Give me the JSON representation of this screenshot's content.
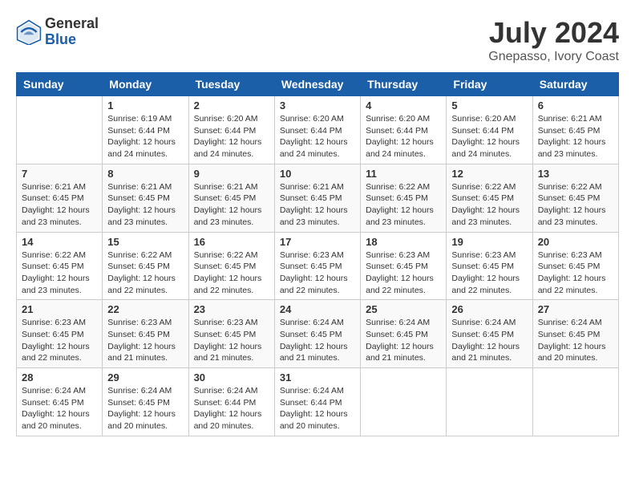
{
  "header": {
    "logo_general": "General",
    "logo_blue": "Blue",
    "month_year": "July 2024",
    "location": "Gnepasso, Ivory Coast"
  },
  "days_of_week": [
    "Sunday",
    "Monday",
    "Tuesday",
    "Wednesday",
    "Thursday",
    "Friday",
    "Saturday"
  ],
  "weeks": [
    [
      {
        "day": "",
        "sunrise": "",
        "sunset": "",
        "daylight": ""
      },
      {
        "day": "1",
        "sunrise": "Sunrise: 6:19 AM",
        "sunset": "Sunset: 6:44 PM",
        "daylight": "Daylight: 12 hours and 24 minutes."
      },
      {
        "day": "2",
        "sunrise": "Sunrise: 6:20 AM",
        "sunset": "Sunset: 6:44 PM",
        "daylight": "Daylight: 12 hours and 24 minutes."
      },
      {
        "day": "3",
        "sunrise": "Sunrise: 6:20 AM",
        "sunset": "Sunset: 6:44 PM",
        "daylight": "Daylight: 12 hours and 24 minutes."
      },
      {
        "day": "4",
        "sunrise": "Sunrise: 6:20 AM",
        "sunset": "Sunset: 6:44 PM",
        "daylight": "Daylight: 12 hours and 24 minutes."
      },
      {
        "day": "5",
        "sunrise": "Sunrise: 6:20 AM",
        "sunset": "Sunset: 6:44 PM",
        "daylight": "Daylight: 12 hours and 24 minutes."
      },
      {
        "day": "6",
        "sunrise": "Sunrise: 6:21 AM",
        "sunset": "Sunset: 6:45 PM",
        "daylight": "Daylight: 12 hours and 23 minutes."
      }
    ],
    [
      {
        "day": "7",
        "sunrise": "Sunrise: 6:21 AM",
        "sunset": "Sunset: 6:45 PM",
        "daylight": "Daylight: 12 hours and 23 minutes."
      },
      {
        "day": "8",
        "sunrise": "Sunrise: 6:21 AM",
        "sunset": "Sunset: 6:45 PM",
        "daylight": "Daylight: 12 hours and 23 minutes."
      },
      {
        "day": "9",
        "sunrise": "Sunrise: 6:21 AM",
        "sunset": "Sunset: 6:45 PM",
        "daylight": "Daylight: 12 hours and 23 minutes."
      },
      {
        "day": "10",
        "sunrise": "Sunrise: 6:21 AM",
        "sunset": "Sunset: 6:45 PM",
        "daylight": "Daylight: 12 hours and 23 minutes."
      },
      {
        "day": "11",
        "sunrise": "Sunrise: 6:22 AM",
        "sunset": "Sunset: 6:45 PM",
        "daylight": "Daylight: 12 hours and 23 minutes."
      },
      {
        "day": "12",
        "sunrise": "Sunrise: 6:22 AM",
        "sunset": "Sunset: 6:45 PM",
        "daylight": "Daylight: 12 hours and 23 minutes."
      },
      {
        "day": "13",
        "sunrise": "Sunrise: 6:22 AM",
        "sunset": "Sunset: 6:45 PM",
        "daylight": "Daylight: 12 hours and 23 minutes."
      }
    ],
    [
      {
        "day": "14",
        "sunrise": "Sunrise: 6:22 AM",
        "sunset": "Sunset: 6:45 PM",
        "daylight": "Daylight: 12 hours and 23 minutes."
      },
      {
        "day": "15",
        "sunrise": "Sunrise: 6:22 AM",
        "sunset": "Sunset: 6:45 PM",
        "daylight": "Daylight: 12 hours and 22 minutes."
      },
      {
        "day": "16",
        "sunrise": "Sunrise: 6:22 AM",
        "sunset": "Sunset: 6:45 PM",
        "daylight": "Daylight: 12 hours and 22 minutes."
      },
      {
        "day": "17",
        "sunrise": "Sunrise: 6:23 AM",
        "sunset": "Sunset: 6:45 PM",
        "daylight": "Daylight: 12 hours and 22 minutes."
      },
      {
        "day": "18",
        "sunrise": "Sunrise: 6:23 AM",
        "sunset": "Sunset: 6:45 PM",
        "daylight": "Daylight: 12 hours and 22 minutes."
      },
      {
        "day": "19",
        "sunrise": "Sunrise: 6:23 AM",
        "sunset": "Sunset: 6:45 PM",
        "daylight": "Daylight: 12 hours and 22 minutes."
      },
      {
        "day": "20",
        "sunrise": "Sunrise: 6:23 AM",
        "sunset": "Sunset: 6:45 PM",
        "daylight": "Daylight: 12 hours and 22 minutes."
      }
    ],
    [
      {
        "day": "21",
        "sunrise": "Sunrise: 6:23 AM",
        "sunset": "Sunset: 6:45 PM",
        "daylight": "Daylight: 12 hours and 22 minutes."
      },
      {
        "day": "22",
        "sunrise": "Sunrise: 6:23 AM",
        "sunset": "Sunset: 6:45 PM",
        "daylight": "Daylight: 12 hours and 21 minutes."
      },
      {
        "day": "23",
        "sunrise": "Sunrise: 6:23 AM",
        "sunset": "Sunset: 6:45 PM",
        "daylight": "Daylight: 12 hours and 21 minutes."
      },
      {
        "day": "24",
        "sunrise": "Sunrise: 6:24 AM",
        "sunset": "Sunset: 6:45 PM",
        "daylight": "Daylight: 12 hours and 21 minutes."
      },
      {
        "day": "25",
        "sunrise": "Sunrise: 6:24 AM",
        "sunset": "Sunset: 6:45 PM",
        "daylight": "Daylight: 12 hours and 21 minutes."
      },
      {
        "day": "26",
        "sunrise": "Sunrise: 6:24 AM",
        "sunset": "Sunset: 6:45 PM",
        "daylight": "Daylight: 12 hours and 21 minutes."
      },
      {
        "day": "27",
        "sunrise": "Sunrise: 6:24 AM",
        "sunset": "Sunset: 6:45 PM",
        "daylight": "Daylight: 12 hours and 20 minutes."
      }
    ],
    [
      {
        "day": "28",
        "sunrise": "Sunrise: 6:24 AM",
        "sunset": "Sunset: 6:45 PM",
        "daylight": "Daylight: 12 hours and 20 minutes."
      },
      {
        "day": "29",
        "sunrise": "Sunrise: 6:24 AM",
        "sunset": "Sunset: 6:45 PM",
        "daylight": "Daylight: 12 hours and 20 minutes."
      },
      {
        "day": "30",
        "sunrise": "Sunrise: 6:24 AM",
        "sunset": "Sunset: 6:44 PM",
        "daylight": "Daylight: 12 hours and 20 minutes."
      },
      {
        "day": "31",
        "sunrise": "Sunrise: 6:24 AM",
        "sunset": "Sunset: 6:44 PM",
        "daylight": "Daylight: 12 hours and 20 minutes."
      },
      {
        "day": "",
        "sunrise": "",
        "sunset": "",
        "daylight": ""
      },
      {
        "day": "",
        "sunrise": "",
        "sunset": "",
        "daylight": ""
      },
      {
        "day": "",
        "sunrise": "",
        "sunset": "",
        "daylight": ""
      }
    ]
  ]
}
